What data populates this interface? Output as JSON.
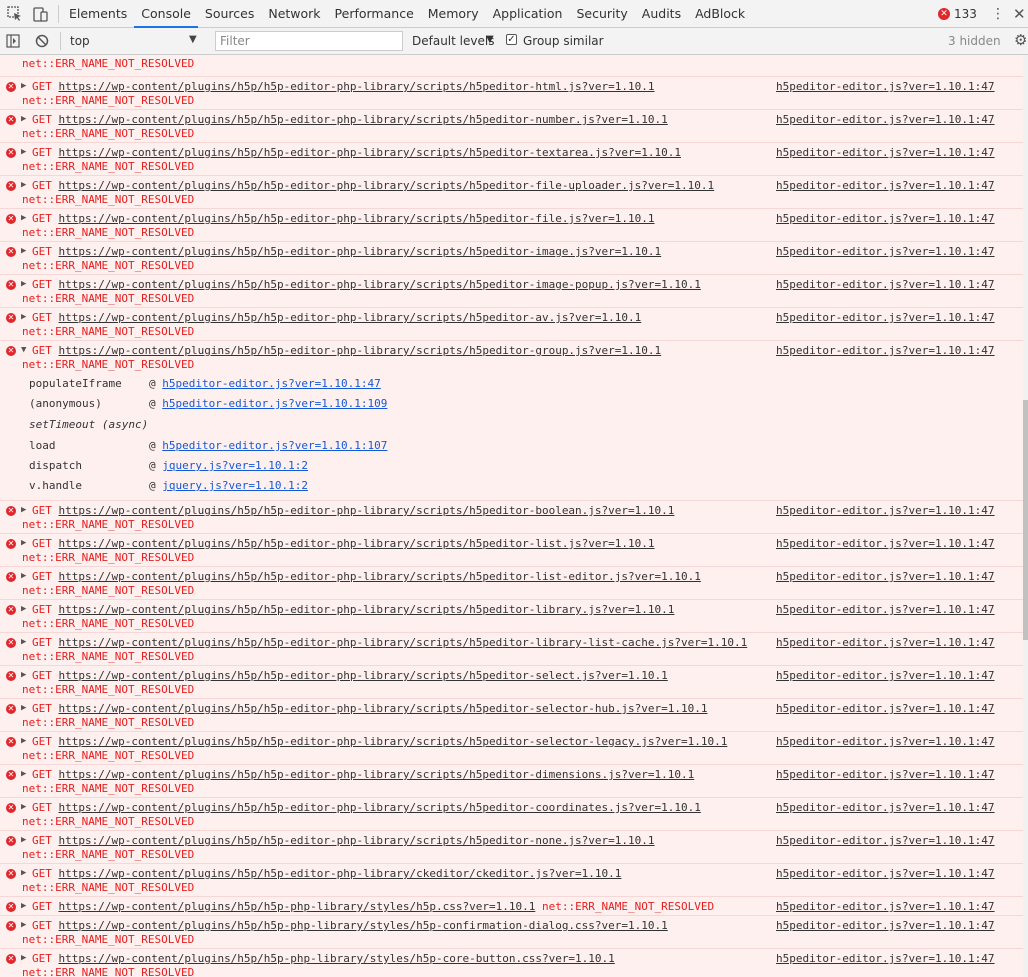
{
  "tabs": [
    "Elements",
    "Console",
    "Sources",
    "Network",
    "Performance",
    "Memory",
    "Application",
    "Security",
    "Audits",
    "AdBlock"
  ],
  "active_tab": "Console",
  "error_count": "133",
  "toolbar": {
    "context": "top",
    "filter_placeholder": "Filter",
    "levels": "Default levels",
    "group_similar": "Group similar",
    "hidden": "3 hidden"
  },
  "net_error": "net::ERR_NAME_NOT_RESOLVED",
  "method": "GET",
  "source": "h5peditor-editor.js?ver=1.10.1:47",
  "truncated_line": "net::ERR_NAME_NOT_RESOLVED",
  "messages": [
    {
      "url": "https://wp-content/plugins/h5p/h5p-editor-php-library/scripts/h5peditor-html.js?ver=1.10.1"
    },
    {
      "url": "https://wp-content/plugins/h5p/h5p-editor-php-library/scripts/h5peditor-number.js?ver=1.10.1"
    },
    {
      "url": "https://wp-content/plugins/h5p/h5p-editor-php-library/scripts/h5peditor-textarea.js?ver=1.10.1"
    },
    {
      "url": "https://wp-content/plugins/h5p/h5p-editor-php-library/scripts/h5peditor-file-uploader.js?ver=1.10.1"
    },
    {
      "url": "https://wp-content/plugins/h5p/h5p-editor-php-library/scripts/h5peditor-file.js?ver=1.10.1"
    },
    {
      "url": "https://wp-content/plugins/h5p/h5p-editor-php-library/scripts/h5peditor-image.js?ver=1.10.1"
    },
    {
      "url": "https://wp-content/plugins/h5p/h5p-editor-php-library/scripts/h5peditor-image-popup.js?ver=1.10.1"
    },
    {
      "url": "https://wp-content/plugins/h5p/h5p-editor-php-library/scripts/h5peditor-av.js?ver=1.10.1"
    },
    {
      "url": "https://wp-content/plugins/h5p/h5p-editor-php-library/scripts/h5peditor-group.js?ver=1.10.1",
      "expanded": true
    },
    {
      "url": "https://wp-content/plugins/h5p/h5p-editor-php-library/scripts/h5peditor-boolean.js?ver=1.10.1"
    },
    {
      "url": "https://wp-content/plugins/h5p/h5p-editor-php-library/scripts/h5peditor-list.js?ver=1.10.1"
    },
    {
      "url": "https://wp-content/plugins/h5p/h5p-editor-php-library/scripts/h5peditor-list-editor.js?ver=1.10.1"
    },
    {
      "url": "https://wp-content/plugins/h5p/h5p-editor-php-library/scripts/h5peditor-library.js?ver=1.10.1"
    },
    {
      "url": "https://wp-content/plugins/h5p/h5p-editor-php-library/scripts/h5peditor-library-list-cache.js?ver=1.10.1"
    },
    {
      "url": "https://wp-content/plugins/h5p/h5p-editor-php-library/scripts/h5peditor-select.js?ver=1.10.1"
    },
    {
      "url": "https://wp-content/plugins/h5p/h5p-editor-php-library/scripts/h5peditor-selector-hub.js?ver=1.10.1"
    },
    {
      "url": "https://wp-content/plugins/h5p/h5p-editor-php-library/scripts/h5peditor-selector-legacy.js?ver=1.10.1"
    },
    {
      "url": "https://wp-content/plugins/h5p/h5p-editor-php-library/scripts/h5peditor-dimensions.js?ver=1.10.1"
    },
    {
      "url": "https://wp-content/plugins/h5p/h5p-editor-php-library/scripts/h5peditor-coordinates.js?ver=1.10.1"
    },
    {
      "url": "https://wp-content/plugins/h5p/h5p-editor-php-library/scripts/h5peditor-none.js?ver=1.10.1"
    },
    {
      "url": "https://wp-content/plugins/h5p/h5p-editor-php-library/ckeditor/ckeditor.js?ver=1.10.1"
    },
    {
      "url": "https://wp-content/plugins/h5p/h5p-php-library/styles/h5p.css?ver=1.10.1",
      "inline_net": true
    },
    {
      "url": "https://wp-content/plugins/h5p/h5p-php-library/styles/h5p-confirmation-dialog.css?ver=1.10.1"
    },
    {
      "url": "https://wp-content/plugins/h5p/h5p-php-library/styles/h5p-core-button.css?ver=1.10.1"
    }
  ],
  "stack_trace": [
    {
      "fn": "populateIframe",
      "link": "h5peditor-editor.js?ver=1.10.1:47"
    },
    {
      "fn": "(anonymous)",
      "link": "h5peditor-editor.js?ver=1.10.1:109"
    },
    {
      "async": "setTimeout (async)"
    },
    {
      "fn": "load",
      "link": "h5peditor-editor.js?ver=1.10.1:107"
    },
    {
      "fn": "dispatch",
      "link": "jquery.js?ver=1.10.1:2"
    },
    {
      "fn": "v.handle",
      "link": "jquery.js?ver=1.10.1:2"
    }
  ]
}
